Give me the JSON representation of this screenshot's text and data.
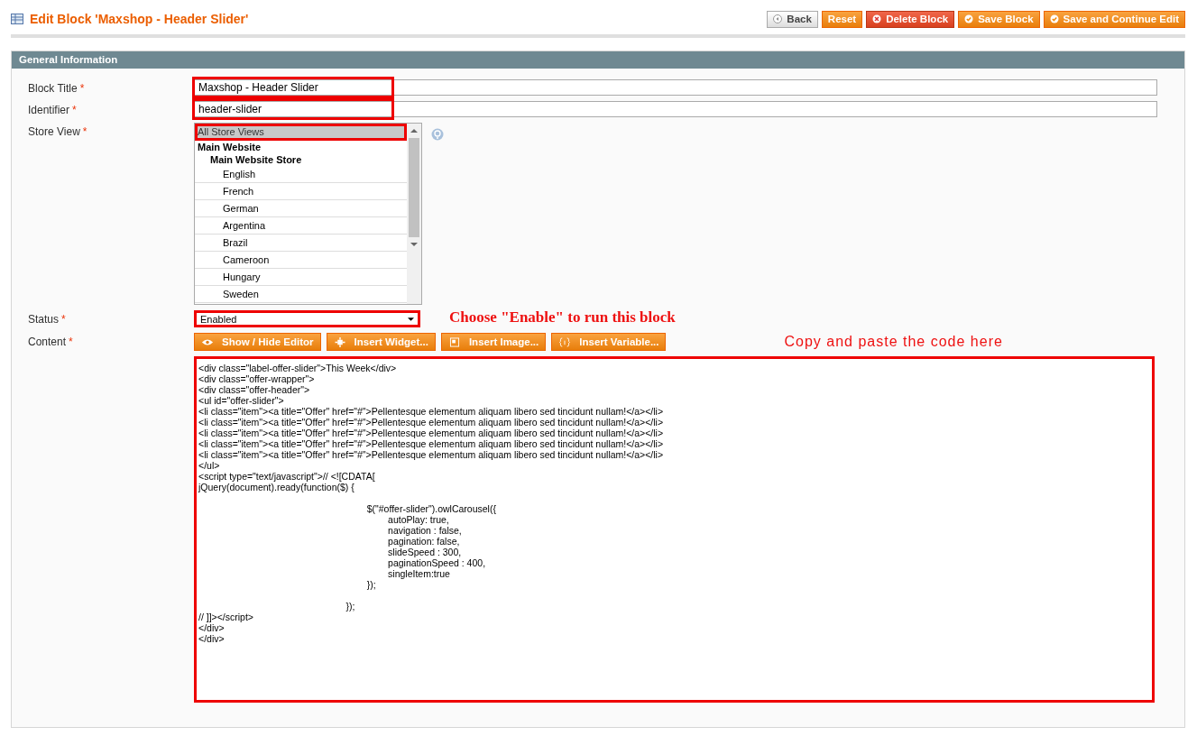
{
  "page_title": "Edit Block 'Maxshop - Header Slider'",
  "actions": [
    {
      "label": "Back",
      "kind": "back"
    },
    {
      "label": "Reset",
      "kind": "plain"
    },
    {
      "label": "Delete Block",
      "kind": "delete"
    },
    {
      "label": "Save Block",
      "kind": "save"
    },
    {
      "label": "Save and Continue Edit",
      "kind": "save"
    }
  ],
  "section": {
    "title": "General Information"
  },
  "block_title": {
    "label": "Block Title",
    "required_mark": "*",
    "value": "Maxshop - Header Slider",
    "highlighted": true
  },
  "identifier": {
    "label": "Identifier",
    "required_mark": "*",
    "value": "header-slider",
    "highlighted": true
  },
  "store_view": {
    "label": "Store View",
    "required_mark": "*",
    "options": [
      {
        "label": "All Store Views",
        "selected": true,
        "highlighted": true
      },
      {
        "label": "Main Website",
        "children": [
          {
            "label": "Main Website Store",
            "children": [
              {
                "label": "English",
                "selected": false,
                "highlighted": false
              },
              {
                "label": "French",
                "selected": false,
                "highlighted": false
              },
              {
                "label": "German",
                "selected": false,
                "highlighted": false
              },
              {
                "label": "Argentina",
                "selected": false,
                "highlighted": false
              },
              {
                "label": "Brazil",
                "selected": false,
                "highlighted": false
              },
              {
                "label": "Cameroon",
                "selected": false,
                "highlighted": false
              },
              {
                "label": "Hungary",
                "selected": false,
                "highlighted": false
              },
              {
                "label": "Sweden",
                "selected": false,
                "highlighted": false
              }
            ]
          }
        ]
      }
    ]
  },
  "status": {
    "label": "Status",
    "required_mark": "*",
    "value": "Enabled",
    "highlighted": true,
    "annotation": "Choose \"Enable\" to run this block"
  },
  "content": {
    "label": "Content",
    "required_mark": "*",
    "editor_buttons": [
      {
        "label": "Show / Hide Editor",
        "kind": "eye"
      },
      {
        "label": "Insert Widget...",
        "kind": "widget"
      },
      {
        "label": "Insert Image...",
        "kind": "image"
      },
      {
        "label": "Insert Variable...",
        "kind": "variable"
      }
    ],
    "annotation": "Copy and paste the code here",
    "highlighted": true,
    "code_blocks": [
      [
        "<div class=\"label-offer-slider\">This Week</div>",
        "<div class=\"offer-wrapper\">",
        "<div class=\"offer-header\">",
        "<ul id=\"offer-slider\">",
        "<li class=\"item\"><a title=\"Offer\" href=\"#\">Pellentesque elementum aliquam libero sed tincidunt nullam!</a></li>",
        "<li class=\"item\"><a title=\"Offer\" href=\"#\">Pellentesque elementum aliquam libero sed tincidunt nullam!</a></li>",
        "<li class=\"item\"><a title=\"Offer\" href=\"#\">Pellentesque elementum aliquam libero sed tincidunt nullam!</a></li>",
        "<li class=\"item\"><a title=\"Offer\" href=\"#\">Pellentesque elementum aliquam libero sed tincidunt nullam!</a></li>",
        "<li class=\"item\"><a title=\"Offer\" href=\"#\">Pellentesque elementum aliquam libero sed tincidunt nullam!</a></li>",
        "</ul>",
        "<script type=\"text/javascript\">// <![CDATA[",
        "jQuery(document).ready(function($) {"
      ],
      [
        "\t\t\t\t\t\t\t\t$(\"#offer-slider\").owlCarousel({",
        "\t\t\t\t\t\t\t\t\tautoPlay: true,",
        "\t\t\t\t\t\t\t\t\tnavigation : false,",
        "\t\t\t\t\t\t\t\t\tpagination: false,",
        "\t\t\t\t\t\t\t\t\tslideSpeed : 300,",
        "\t\t\t\t\t\t\t\t\tpaginationSpeed : 400,",
        "\t\t\t\t\t\t\t\t\tsingleItem:true",
        "\t\t\t\t\t\t\t\t});"
      ],
      [
        "\t\t\t\t\t\t\t});",
        "// ]]></script>",
        "</div>",
        "</div>"
      ]
    ]
  }
}
